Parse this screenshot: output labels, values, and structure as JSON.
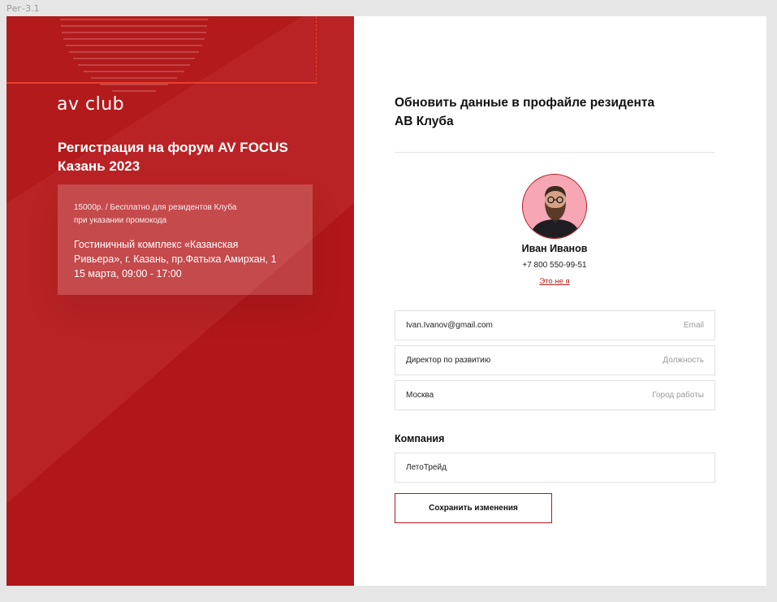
{
  "frame_label": "Рег-3.1",
  "left": {
    "logo": "av club",
    "event_title_line1": "Регистрация на форум AV FOCUS",
    "event_title_line2": "Казань 2023",
    "price_line1": "15000р. / Бесплатно для резидентов Клуба",
    "price_line2": "при указании промокода",
    "venue_line1": "Гостиничный комплекс «Казанская",
    "venue_line2": "Ривьера», г. Казань, пр.Фатыха Амирхан, 1",
    "venue_line3": "15 марта, 09:00 - 17:00"
  },
  "right": {
    "title_line1": "Обновить данные в профайле резидента",
    "title_line2": "АВ Клуба",
    "user_name": "Иван Иванов",
    "user_phone": "+7 800 550-99-51",
    "not_me_link": "Это не я",
    "fields": [
      {
        "value": "Ivan.Ivanov@gmail.com",
        "placeholder": "Email"
      },
      {
        "value": "Директор по развитию",
        "placeholder": "Должность"
      },
      {
        "value": "Москва",
        "placeholder": "Город работы"
      }
    ],
    "company_label": "Компания",
    "company_value": "ЛетоТрейд",
    "save_button": "Сохранить изменения"
  },
  "colors": {
    "brand_red": "#b31a1b",
    "guide_red": "#e8402f"
  },
  "icons": {
    "avatar": "user-avatar-photo"
  }
}
